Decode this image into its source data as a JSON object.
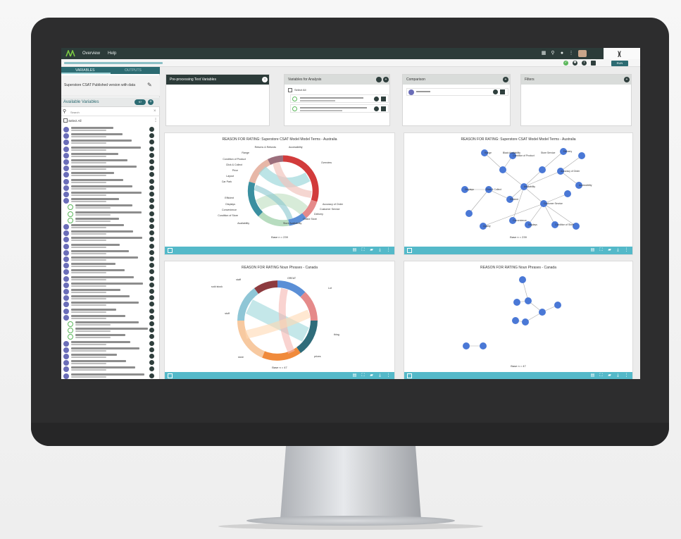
{
  "topbar": {
    "nav": [
      "Overview",
      "Help"
    ],
    "icons": [
      "grid-icon",
      "search-icon",
      "bell-icon",
      "kebab-icon",
      "avatar",
      "brand-logo"
    ]
  },
  "subbar": {
    "run_label": "RUN"
  },
  "left_panel": {
    "tabs": [
      "VARIABLES",
      "OUTPUTS"
    ],
    "dataset_name": "Superstore CSAT Published version with data",
    "available_title": "Available Variables",
    "available_count": "97",
    "search_placeholder": "Search",
    "select_all_label": "Select All"
  },
  "panels": {
    "preprocessing": {
      "title": "Pre-processing Text Variables"
    },
    "analysis": {
      "title": "Variables for Analysis",
      "select_all": "Select All"
    },
    "comparison": {
      "title": "Comparison"
    },
    "filters": {
      "title": "Filters"
    }
  },
  "charts": [
    {
      "title": "REASON FOR RATING: Superstore CSAT Model Model Terms - Australia",
      "base": "Base n = 239",
      "labels": [
        "Returns & Refunds",
        "Accessibility",
        "Range",
        "Condition of Product",
        "Click & Collect",
        "Price",
        "Layout",
        "Car Park",
        "Efficient",
        "Displays",
        "Convenience",
        "Condition of Store",
        "Availability",
        "Store Availability",
        "Online Store",
        "Delivery",
        "Customer Service",
        "Accuracy of Order",
        "Overview"
      ]
    },
    {
      "title": "REASON FOR RATING: Superstore CSAT Model Model Terms - Australia",
      "base": "Base n = 239",
      "nodes": [
        "Range",
        "Black Availability",
        "Store Service",
        "Delivery",
        "Condition of Product",
        "Accuracy of Order",
        "Click & Collect",
        "Displays",
        "Efficient",
        "Availability",
        "Accessibility",
        "Customer Service",
        "Convenience",
        "Displays",
        "Quality",
        "Condition of Store"
      ]
    },
    {
      "title": "REASON FOR RATING Noun Phrases - Canada",
      "base": "Base n = 47",
      "labels": [
        "sold stock",
        "staff",
        "GREAT",
        "Lot",
        "stuff",
        "thing",
        "store",
        "prices"
      ]
    },
    {
      "title": "REASON FOR RATING Noun Phrases - Canada",
      "base": "Base n = 47"
    }
  ],
  "colors": {
    "topbar": "#2c3b39",
    "accent": "#2c6b72",
    "footer": "#54b9c9",
    "node": "#4a78d6"
  }
}
